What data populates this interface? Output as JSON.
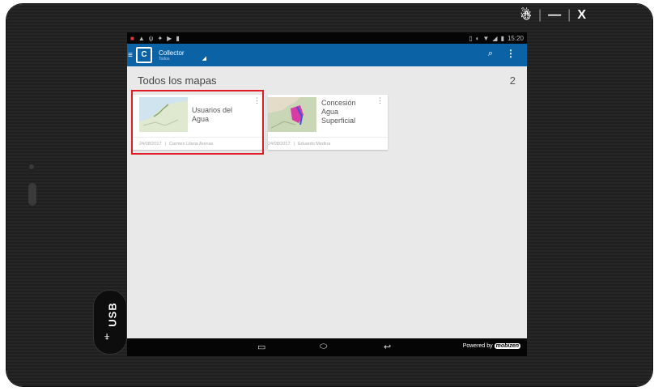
{
  "window": {
    "controls": [
      "☃",
      "—",
      "X"
    ],
    "sep": "|"
  },
  "device": {
    "usb_label": "USB",
    "usb_icon": "usb-icon"
  },
  "status_bar": {
    "left_icons": [
      "■",
      "▲",
      "ψ",
      "✦",
      "▶",
      "▮"
    ],
    "time": "15:20",
    "right_icons": [
      "▯",
      "◐",
      "▼",
      "◢",
      "▮"
    ]
  },
  "app_bar": {
    "title": "Collector",
    "subtitle": "Todos",
    "dropdown": "◢",
    "search_icon": "⌕",
    "more_icon": "⋮"
  },
  "page": {
    "title": "Todos los mapas",
    "count": "2"
  },
  "maps": [
    {
      "title": "Usuarios del Agua",
      "date": "24/08/2017",
      "author": "Carmen Lilaria Arenas"
    },
    {
      "title": "Concesión Agua Superficial",
      "date": "24/08/2017",
      "author": "Eduardo Medina"
    }
  ],
  "navbar": {
    "recent": "▭",
    "home": "⬭",
    "back": "↩",
    "powered_by": "Powered by",
    "brand": "mobizen"
  },
  "colors": {
    "app_bar": "#0b63a6",
    "highlight": "#e01b24"
  }
}
